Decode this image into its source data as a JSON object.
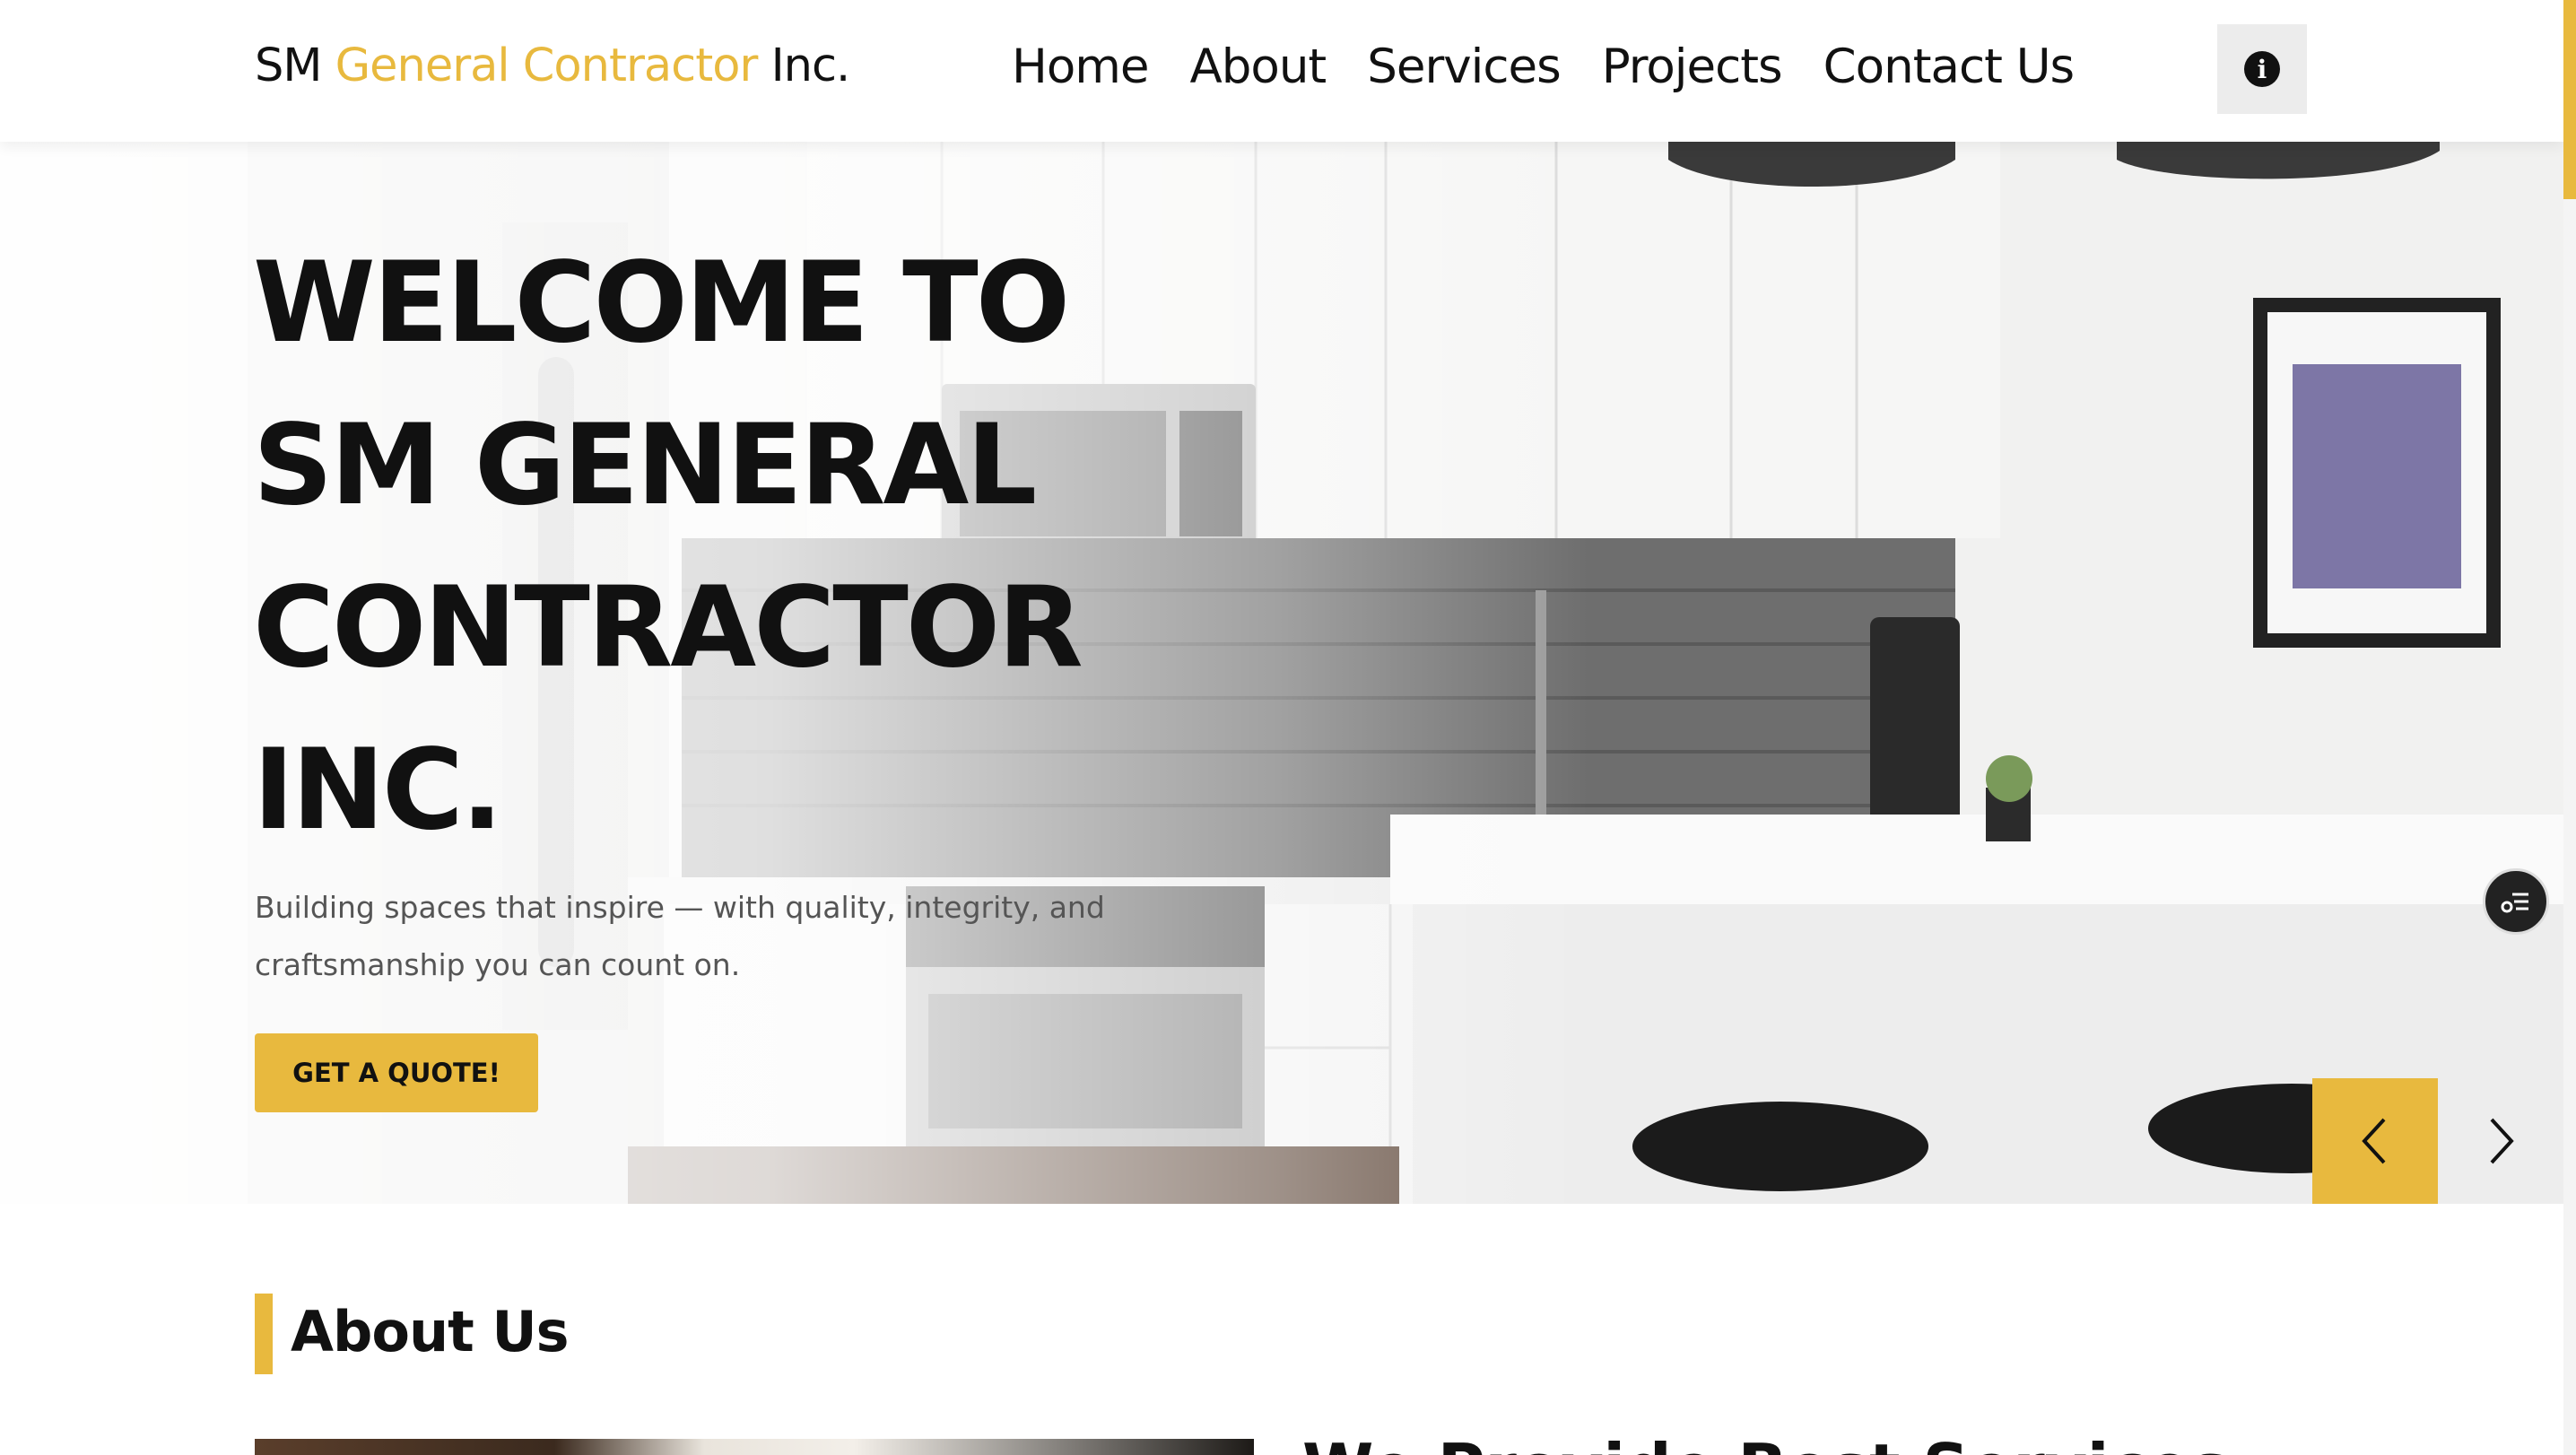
{
  "header": {
    "logo": {
      "prefix": "SM",
      "accent": "General Contractor",
      "suffix": "Inc."
    },
    "nav": [
      "Home",
      "About",
      "Services",
      "Projects",
      "Contact Us"
    ],
    "info_icon": "info-circle-icon"
  },
  "hero": {
    "title_lines": [
      "WELCOME TO",
      "SM GENERAL",
      "CONTRACTOR",
      "INC."
    ],
    "subtitle": "Building spaces that inspire — with quality, integrity, and craftsmanship you can count on.",
    "cta_label": "GET A QUOTE!",
    "prev_icon": "chevron-left-icon",
    "next_icon": "chevron-right-icon",
    "floating_icon": "menu-list-icon",
    "background": "kitchen-interior-photo"
  },
  "about": {
    "title": "About Us",
    "heading_partial": "We Provide Best Services"
  },
  "colors": {
    "accent": "#e8b93e",
    "text": "#111111",
    "muted": "#555555",
    "header_bg": "#ffffff"
  }
}
